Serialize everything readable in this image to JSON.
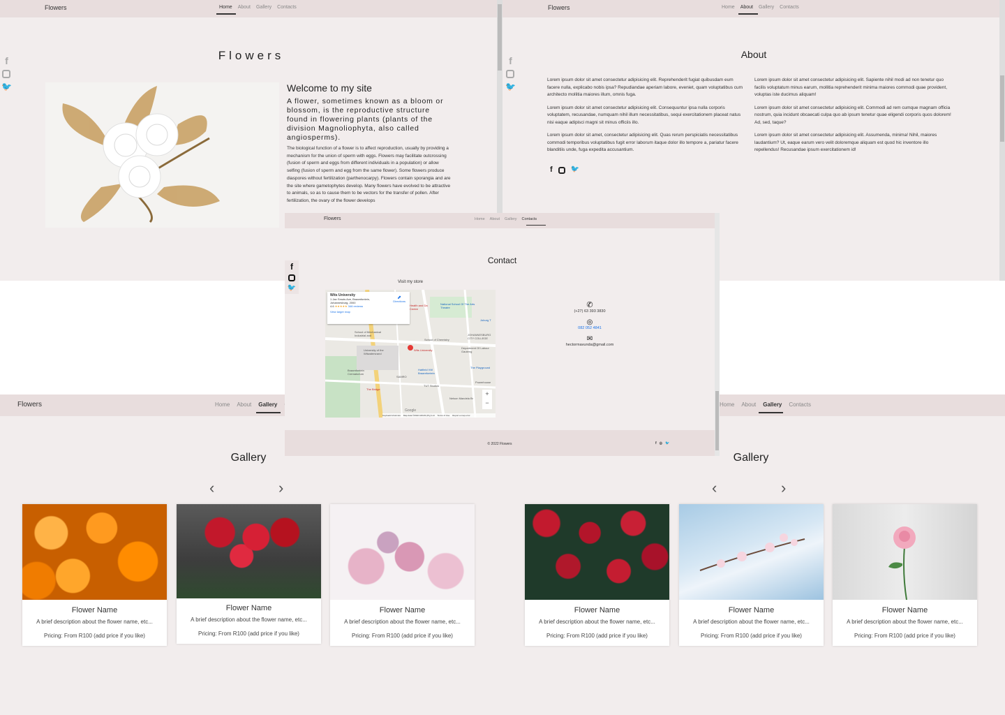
{
  "brand": "Flowers",
  "nav": {
    "home": "Home",
    "about": "About",
    "gallery": "Gallery",
    "contacts": "Contacts"
  },
  "social_icons": [
    "facebook-icon",
    "instagram-icon",
    "twitter-icon"
  ],
  "home": {
    "title": "Flowers",
    "welcome": "Welcome to my site",
    "lead": "A flower, sometimes known as a bloom or blossom, is the reproductive structure found in flowering plants (plants of the division Magnoliophyta, also called angiosperms).",
    "body": "The biological function of a flower is to affect reproduction, usually by providing a mechanism for the union of sperm with eggs. Flowers may facilitate outcrossing (fusion of sperm and eggs from different individuals in a population) or allow selfing (fusion of sperm and egg from the same flower). Some flowers produce diaspores without fertilization (parthenocarpy). Flowers contain sporangia and are the site where gametophytes develop. Many flowers have evolved to be attractive to animals, so as to cause them to be vectors for the transfer of pollen. After fertilization, the ovary of the flower develops"
  },
  "about": {
    "title": "About",
    "left": [
      "Lorem ipsum dolor sit amet consectetur adipisicing elit. Reprehenderit fugiat quibusdam eum facere nulla, explicabo nobis ipsa? Repudiandae aperiam labore, eveniet, quam voluptatibus cum architecto mollitia maiores illum, omnis fuga.",
      "Lorem ipsum dolor sit amet consectetur adipisicing elit. Consequuntur ipsa nulla corporis voluptatem, recusandae, numquam nihil illum necessitatibus, sequi exercitationem placeat natus nisi eaque adipisci magni sit minus officiis illo.",
      "Lorem ipsum dolor sit amet, consectetur adipisicing elit. Quas rerum perspiciatis necessitatibus commodi temporibus voluptatibus fugit error laborum itaque dolor illo tempore a, pariatur facere blanditiis unde, fuga expedita accusantium."
    ],
    "right": [
      "Lorem ipsum dolor sit amet consectetur adipisicing elit. Sapiente nihil modi ad non tenetur quo facilis voluptatum minus earum, mollitia reprehenderit minima maiores commodi quae provident, voluptas iste ducimus aliquam!",
      "Lorem ipsum dolor sit amet consectetur adipisicing elit. Commodi ad rem cumque magnam officia nostrum, quia incidunt obcaecati culpa quo ab ipsum tenetur quae eligendi corporis quos dolorem! Ad, sed, taque?",
      "Lorem ipsum dolor sit amet consectetur adipisicing elit. Assumenda, minima! Nihil, maiores laudantium? Ut, eaque earum vero velit doloremque aliquam est quod hic inventore illo repellendus! Recusandae ipsum exercitationem id!"
    ]
  },
  "contact": {
    "title": "Contact",
    "visit": "Visit my store",
    "map": {
      "place": "Wits University",
      "address": "1 Jan Smuts Ave, Braamfontein, Johannesburg, 2000",
      "rating": "4.6",
      "stars": "★★★★★",
      "reviews": "346 reviews",
      "directions": "Directions",
      "larger": "View larger map",
      "labels": [
        "School of Mechanical Industrial and",
        "University of the Witwatersrand",
        "School of Chemistry",
        "Wits University",
        "Department Of Labour Gauteng",
        "Braamfontein Crematorium",
        "SAMRO",
        "Hatfield VW Braamfontein",
        "TUT Studios",
        "Nelson Mandela Br",
        "The Bridge",
        "Joburg T",
        "National School Of The Arts Theatre",
        "JOHANNESBURG CITY COLLEGE",
        "The Playground",
        "Powerhouse",
        "Health and Da Centre"
      ],
      "footer": [
        "Keyboard shortcuts",
        "Map data ©2022 AfriGIS (Pty) Ltd",
        "Terms of Use",
        "Report a map error"
      ],
      "google": "Google"
    },
    "phone": "(+27) 63 393 3830",
    "whatsapp": "082 052 4841",
    "email": "hectormavunda@gmail.com",
    "footer": "© 2022 Flowers"
  },
  "gallery": {
    "title": "Gallery",
    "cards_left": [
      {
        "name": "Flower Name",
        "desc": "A brief description about the flower name, etc...",
        "price": "Pricing: From R100 (add price if you like)"
      },
      {
        "name": "Flower Name",
        "desc": "A brief description about the flower name, etc...",
        "price": "Pricing: From R100 (add price if you like)"
      },
      {
        "name": "Flower Name",
        "desc": "A brief description about the flower name, etc...",
        "price": "Pricing: From R100 (add price if you like)"
      }
    ],
    "cards_right": [
      {
        "name": "Flower Name",
        "desc": "A brief description about the flower name, etc...",
        "price": "Pricing: From R100 (add price if you like)"
      },
      {
        "name": "Flower Name",
        "desc": "A brief description about the flower name, etc...",
        "price": "Pricing: From R100 (add price if you like)"
      },
      {
        "name": "Flower Name",
        "desc": "A brief description about the flower name, etc...",
        "price": "Pricing: From R100 (add price if you like)"
      }
    ]
  }
}
